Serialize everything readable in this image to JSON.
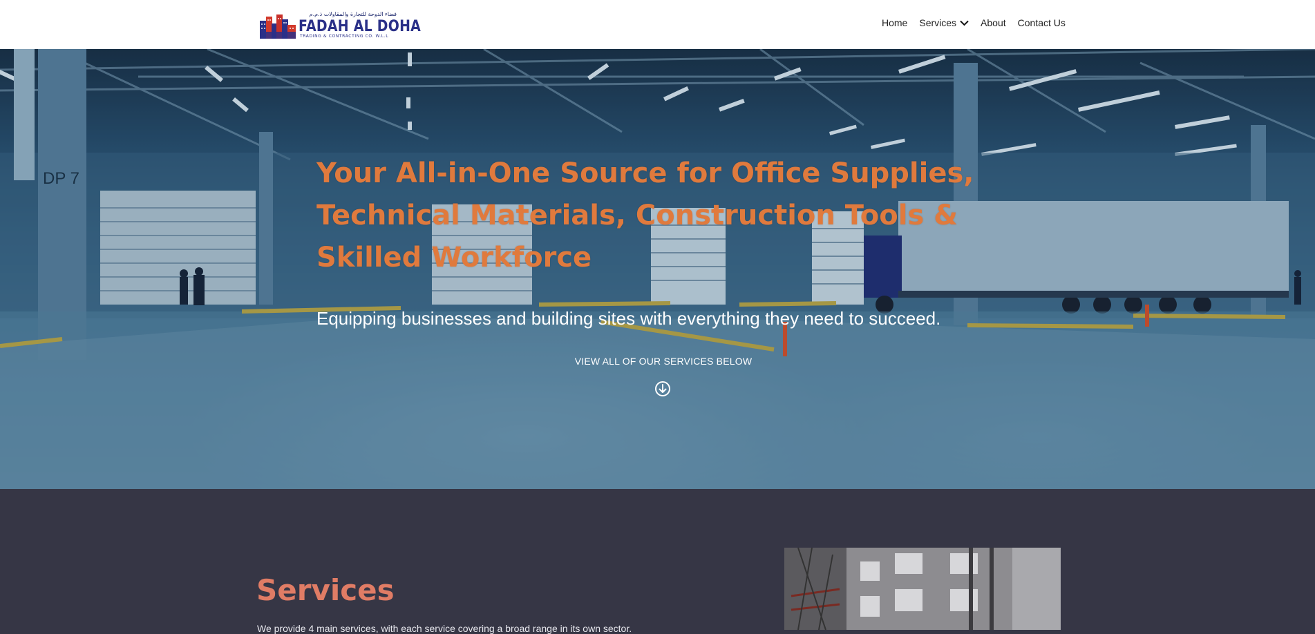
{
  "header": {
    "logo": {
      "arabic_text": "فضاء الدوحة للتجارة والمقاولات ذ.م.م",
      "name": "FADAH AL DOHA",
      "tagline": "TRADING & CONTRACTING CO. W.L.L"
    },
    "nav": {
      "home": "Home",
      "services": "Services",
      "about": "About",
      "contact": "Contact Us"
    }
  },
  "hero": {
    "title": "Your All-in-One Source for Office Supplies, Technical Materials, Construction Tools & Skilled Workforce",
    "subtitle": "Equipping businesses and building sites with everything they need to succeed.",
    "cta": "VIEW ALL OF OUR SERVICES BELOW",
    "cta_icon": "arrow-down-circle-icon"
  },
  "services": {
    "title": "Services",
    "intro": "We provide 4 main services, with each service covering a broad range in its own sector."
  },
  "colors": {
    "accent": "#e07a3d",
    "heading": "#e07c65",
    "section_bg": "#363645",
    "logo_blue": "#2a3088"
  }
}
